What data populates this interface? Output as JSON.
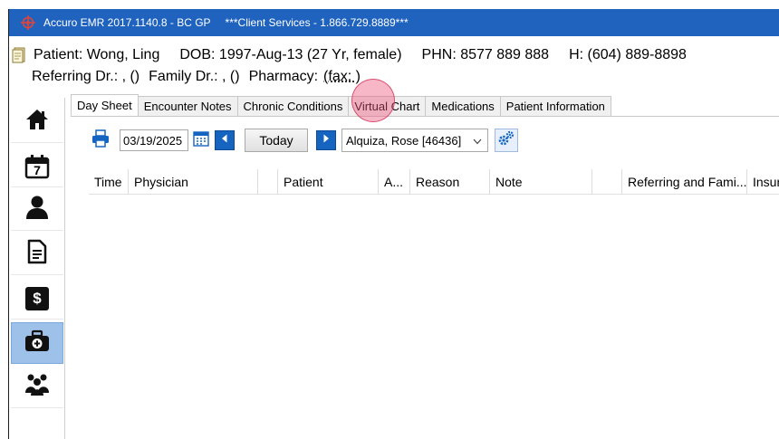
{
  "window": {
    "app_title": "Accuro EMR 2017.1140.8 - BC GP",
    "client_services": "***Client Services - 1.866.729.8889***"
  },
  "patient": {
    "name": "Patient: Wong, Ling",
    "dob": "DOB: 1997-Aug-13 (27 Yr, female)",
    "phn": "PHN: 8577 889 888",
    "home_phone": "H: (604) 889-8898",
    "referring": "Referring Dr.: , ()",
    "family": "Family Dr.: , ()",
    "pharmacy_label": "Pharmacy:",
    "pharmacy_fax": "(fax: )"
  },
  "sidebar": {
    "items": [
      {
        "icon": "home-icon"
      },
      {
        "icon": "calendar-icon",
        "label": "7"
      },
      {
        "icon": "person-icon"
      },
      {
        "icon": "document-icon"
      },
      {
        "icon": "billing-dollar-icon",
        "label": "$"
      },
      {
        "icon": "medical-bag-icon",
        "active": true
      },
      {
        "icon": "group-icon"
      }
    ]
  },
  "tabs": [
    {
      "label": "Day Sheet",
      "active": true
    },
    {
      "label": "Encounter Notes"
    },
    {
      "label": "Chronic Conditions"
    },
    {
      "label": "Virtual Chart"
    },
    {
      "label": "Medications"
    },
    {
      "label": "Patient Information"
    }
  ],
  "toolbar": {
    "date": "03/19/2025",
    "today_label": "Today",
    "physician": "Alquiza, Rose [46436]"
  },
  "grid": {
    "columns": [
      "Time",
      "Physician",
      "",
      "Patient",
      "A...",
      "Reason",
      "Note",
      "",
      "Referring and Fami...",
      "Insure"
    ]
  },
  "colors": {
    "titlebar": "#1f63be",
    "nav_button": "#1565c0",
    "active_sidebar": "#9ec1ea",
    "click_highlight": "#ec547a"
  }
}
